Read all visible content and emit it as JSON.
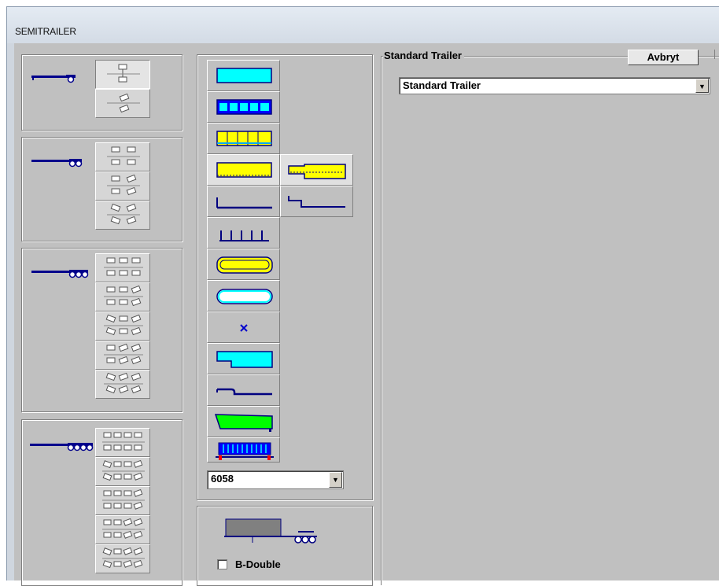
{
  "window": {
    "title": "SEMITRAILER"
  },
  "trailer": {
    "groupbox_label": "Standard Trailer",
    "cancel_label": "Avbryt",
    "type_select": {
      "value": "Standard Trailer"
    }
  },
  "body": {
    "code_select": {
      "value": "6058"
    },
    "bdouble_label": "B-Double",
    "bdouble_checked": false
  },
  "axle_groups": [
    {
      "axles": 1,
      "configs": [
        "single-straight",
        "single-steered"
      ]
    },
    {
      "axles": 2,
      "configs": [
        "tandem-straight",
        "tandem-rear-steered",
        "tandem-all-steered"
      ]
    },
    {
      "axles": 3,
      "configs": [
        "tri-straight",
        "tri-rear-steered",
        "tri-front-steered",
        "tri-middle-rear-steered",
        "tri-all-steered"
      ]
    },
    {
      "axles": 4,
      "configs": [
        "quad-straight",
        "quad-front-steered",
        "quad-rear-steered",
        "quad-two-rear-steered",
        "quad-outer-steered"
      ]
    }
  ],
  "body_types": [
    "box",
    "curtain-side",
    "curtain-side-yellow",
    "dropside",
    "flatbed",
    "stake",
    "tank-yellow",
    "tank-white",
    "none",
    "drop-deck-box",
    "drop-deck-flat",
    "tipper",
    "container-skeletal"
  ],
  "body_types_alt": [
    "drop-deck-dropside",
    "drop-deck-flatbed"
  ],
  "colors": {
    "cyan": "#00ffff",
    "blue": "#0000ff",
    "yellow": "#ffff00",
    "green": "#00ff00",
    "navy": "#000080",
    "face": "#c0c0c0"
  }
}
